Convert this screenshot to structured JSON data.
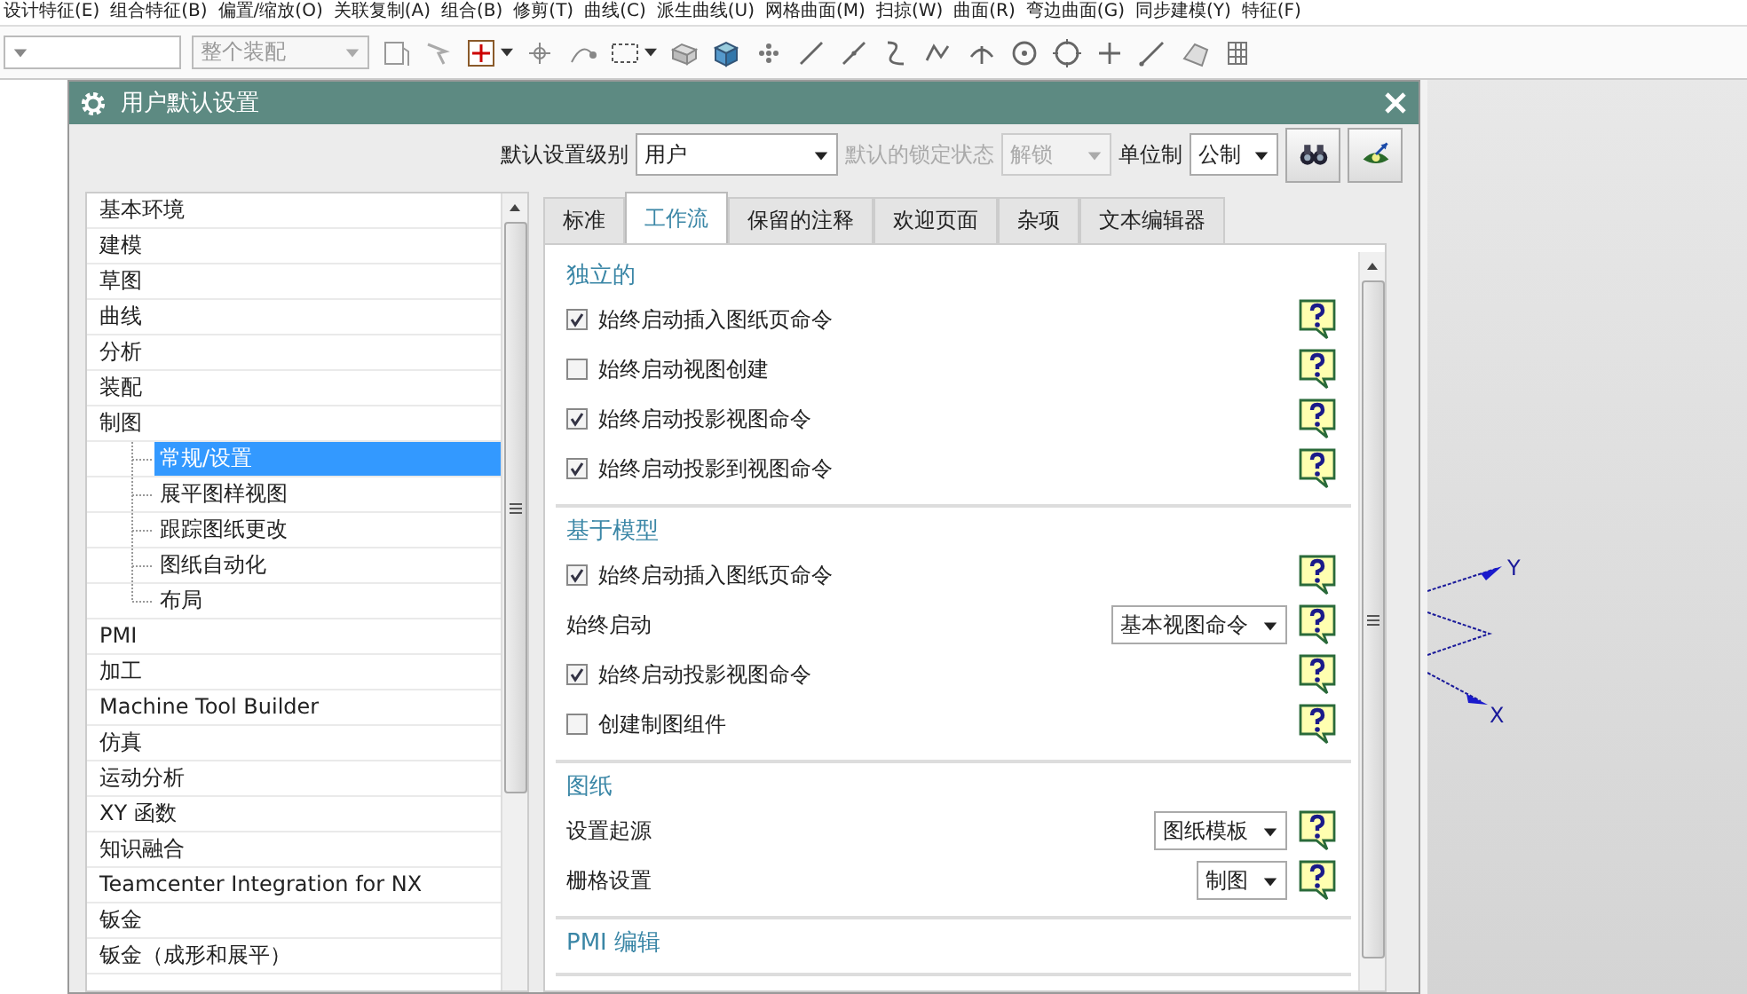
{
  "menu_bar": {
    "items": [
      "设计特征(E)",
      "组合特征(B)",
      "偏置/缩放(O)",
      "关联复制(A)",
      "组合(B)",
      "修剪(T)",
      "曲线(C)",
      "派生曲线(U)",
      "网格曲面(M)",
      "扫掠(W)",
      "曲面(R)",
      "弯边曲面(G)",
      "同步建模(Y)",
      "特征(F)"
    ]
  },
  "toolbar": {
    "assembly_combo": {
      "value": "整个装配",
      "disabled": true
    }
  },
  "dialog": {
    "title": "用户默认设置",
    "header": {
      "level_label": "默认设置级别",
      "level_value": "用户",
      "lock_label": "默认的锁定状态",
      "lock_value": "解锁",
      "lock_disabled": true,
      "unit_label": "单位制",
      "unit_value": "公制"
    },
    "tree": {
      "items": [
        {
          "label": "基本环境",
          "selected": false
        },
        {
          "label": "建模",
          "selected": false
        },
        {
          "label": "草图",
          "selected": false
        },
        {
          "label": "曲线",
          "selected": false
        },
        {
          "label": "分析",
          "selected": false
        },
        {
          "label": "装配",
          "selected": false
        },
        {
          "label": "制图",
          "selected": false,
          "children": [
            {
              "label": "常规/设置",
              "selected": true
            },
            {
              "label": "展平图样视图",
              "selected": false
            },
            {
              "label": "跟踪图纸更改",
              "selected": false
            },
            {
              "label": "图纸自动化",
              "selected": false
            },
            {
              "label": "布局",
              "selected": false
            }
          ]
        },
        {
          "label": "PMI",
          "selected": false
        },
        {
          "label": "加工",
          "selected": false
        },
        {
          "label": "Machine Tool Builder",
          "selected": false
        },
        {
          "label": "仿真",
          "selected": false
        },
        {
          "label": "运动分析",
          "selected": false
        },
        {
          "label": "XY 函数",
          "selected": false
        },
        {
          "label": "知识融合",
          "selected": false
        },
        {
          "label": "Teamcenter Integration for NX",
          "selected": false
        },
        {
          "label": "钣金",
          "selected": false
        },
        {
          "label": "钣金（成形和展平）",
          "selected": false
        }
      ]
    },
    "tabs": [
      {
        "label": "标准",
        "selected": false
      },
      {
        "label": "工作流",
        "selected": true
      },
      {
        "label": "保留的注释",
        "selected": false
      },
      {
        "label": "欢迎页面",
        "selected": false
      },
      {
        "label": "杂项",
        "selected": false
      },
      {
        "label": "文本编辑器",
        "selected": false
      }
    ],
    "sections": [
      {
        "title": "独立的",
        "rows": [
          {
            "kind": "checkbox",
            "label": "始终启动插入图纸页命令",
            "checked": true
          },
          {
            "kind": "checkbox",
            "label": "始终启动视图创建",
            "checked": false
          },
          {
            "kind": "checkbox",
            "label": "始终启动投影视图命令",
            "checked": true
          },
          {
            "kind": "checkbox",
            "label": "始终启动投影到视图命令",
            "checked": true
          }
        ]
      },
      {
        "title": "基于模型",
        "rows": [
          {
            "kind": "checkbox",
            "label": "始终启动插入图纸页命令",
            "checked": true
          },
          {
            "kind": "dropdown",
            "label": "始终启动",
            "value": "基本视图命令"
          },
          {
            "kind": "checkbox",
            "label": "始终启动投影视图命令",
            "checked": true
          },
          {
            "kind": "checkbox",
            "label": "创建制图组件",
            "checked": false
          }
        ]
      },
      {
        "title": "图纸",
        "rows": [
          {
            "kind": "dropdown",
            "label": "设置起源",
            "value": "图纸模板"
          },
          {
            "kind": "dropdown",
            "label": "栅格设置",
            "value": "制图"
          }
        ]
      },
      {
        "title": "PMI 编辑"
      }
    ]
  },
  "viewport": {
    "axis_labels": [
      "Y",
      "X"
    ]
  }
}
